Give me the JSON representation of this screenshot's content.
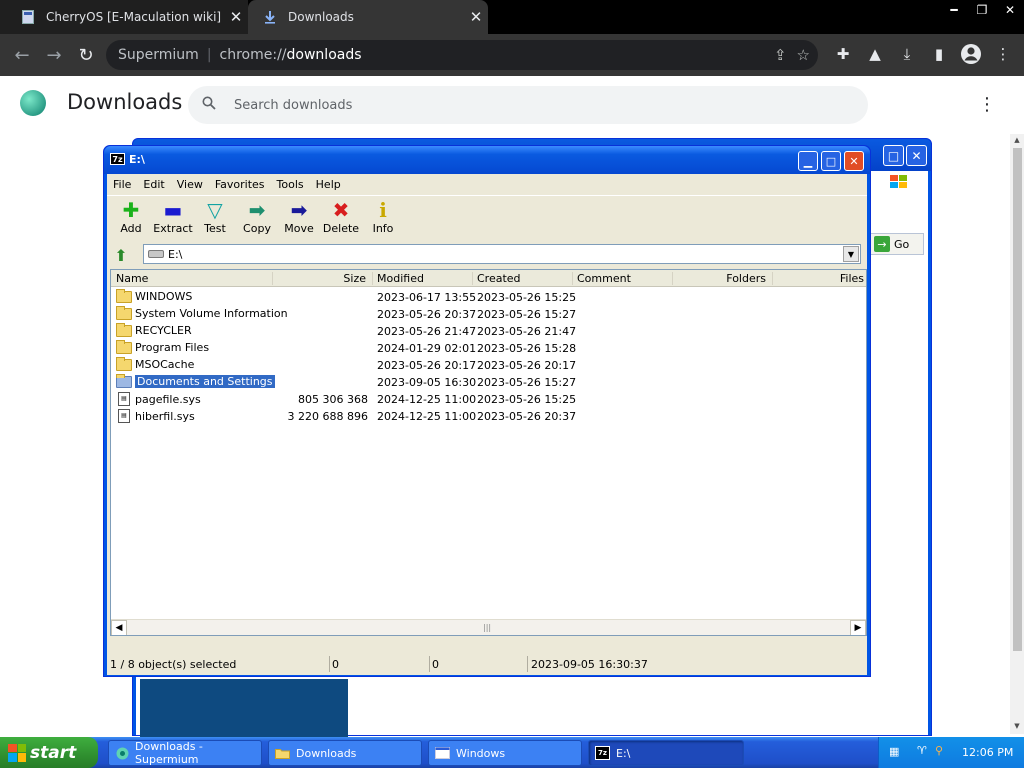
{
  "browser": {
    "tabs": [
      {
        "title": "CherryOS [E-Maculation wiki]",
        "close": "✕"
      },
      {
        "title": "Downloads",
        "close": "✕"
      }
    ],
    "omnibox": {
      "site": "Supermium",
      "url_scheme": "chrome://",
      "url_host": "downloads"
    }
  },
  "downloads_page": {
    "title": "Downloads",
    "search_placeholder": "Search downloads"
  },
  "bg_window": {
    "go_label": "Go"
  },
  "zip_window": {
    "title": "E:\\",
    "app_icon_text": "7z",
    "menu": [
      "File",
      "Edit",
      "View",
      "Favorites",
      "Tools",
      "Help"
    ],
    "toolbar": [
      "Add",
      "Extract",
      "Test",
      "Copy",
      "Move",
      "Delete",
      "Info"
    ],
    "address": "E:\\",
    "columns": [
      "Name",
      "Size",
      "Modified",
      "Created",
      "Comment",
      "Folders",
      "Files"
    ],
    "rows": [
      {
        "name": "WINDOWS",
        "type": "folder",
        "size": "",
        "modified": "2023-06-17 13:55",
        "created": "2023-05-26 15:25"
      },
      {
        "name": "System Volume Information",
        "type": "folder",
        "size": "",
        "modified": "2023-05-26 20:37",
        "created": "2023-05-26 15:27"
      },
      {
        "name": "RECYCLER",
        "type": "folder",
        "size": "",
        "modified": "2023-05-26 21:47",
        "created": "2023-05-26 21:47"
      },
      {
        "name": "Program Files",
        "type": "folder",
        "size": "",
        "modified": "2024-01-29 02:01",
        "created": "2023-05-26 15:28"
      },
      {
        "name": "MSOCache",
        "type": "folder",
        "size": "",
        "modified": "2023-05-26 20:17",
        "created": "2023-05-26 20:17"
      },
      {
        "name": "Documents and Settings",
        "type": "folder",
        "size": "",
        "modified": "2023-09-05 16:30",
        "created": "2023-05-26 15:27",
        "selected": true
      },
      {
        "name": "pagefile.sys",
        "type": "file",
        "size": "805 306 368",
        "modified": "2024-12-25 11:00",
        "created": "2023-05-26 15:25"
      },
      {
        "name": "hiberfil.sys",
        "type": "file",
        "size": "3 220 688 896",
        "modified": "2024-12-25 11:00",
        "created": "2023-05-26 20:37"
      }
    ],
    "status": {
      "selection": "1 / 8 object(s) selected",
      "size": "0",
      "packed": "0",
      "date": "2023-09-05 16:30:37"
    }
  },
  "taskbar": {
    "start_label": "start",
    "buttons": [
      "Downloads - Supermium",
      "Downloads",
      "Windows",
      "E:\\"
    ],
    "clock": "12:06 PM"
  },
  "colors": {
    "xp_blue": "#0055e5",
    "selection": "#316ac5",
    "chrome_dark": "#353535"
  }
}
